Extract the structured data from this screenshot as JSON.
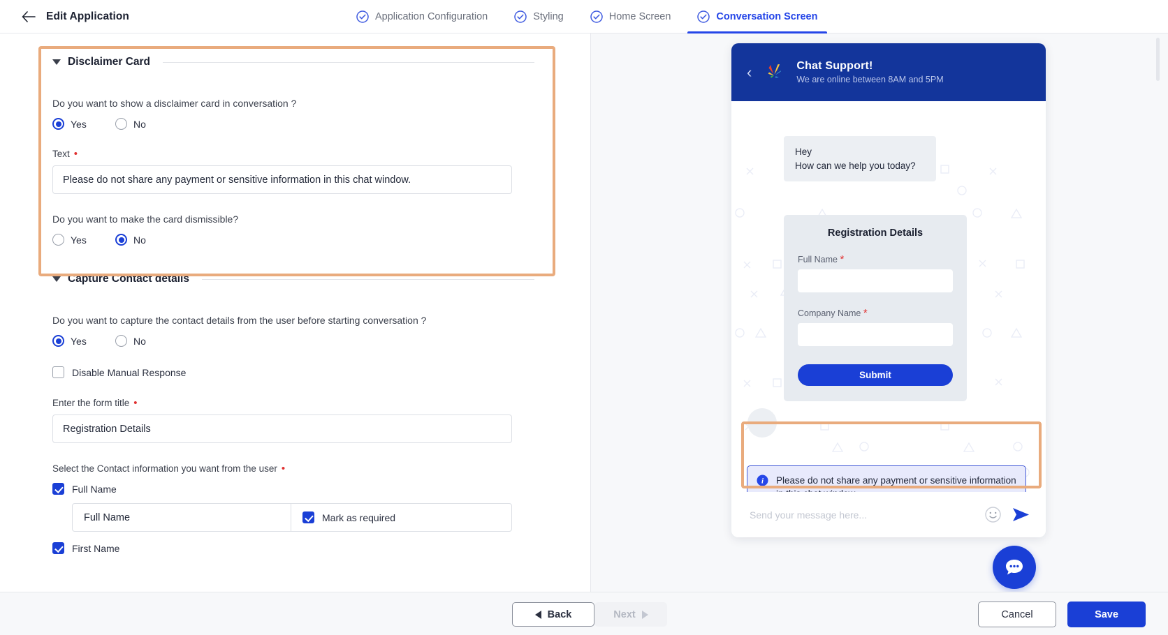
{
  "header": {
    "back_icon": "arrow-left-icon",
    "title": "Edit Application",
    "steps": [
      {
        "label": "Application Configuration",
        "icon": "check-circle-icon",
        "active": false
      },
      {
        "label": "Styling",
        "icon": "check-circle-icon",
        "active": false
      },
      {
        "label": "Home Screen",
        "icon": "check-circle-icon",
        "active": false
      },
      {
        "label": "Conversation Screen",
        "icon": "check-circle-icon",
        "active": true
      }
    ]
  },
  "disclaimer_section": {
    "title": "Disclaimer Card",
    "show_question": "Do you want to show a disclaimer card in conversation ?",
    "show_options": [
      {
        "label": "Yes",
        "selected": true
      },
      {
        "label": "No",
        "selected": false
      }
    ],
    "text_label": "Text",
    "text_value": "Please do not share any payment or sensitive information in this chat window.",
    "dismissible_question": "Do you want to make the card dismissible?",
    "dismissible_options": [
      {
        "label": "Yes",
        "selected": false
      },
      {
        "label": "No",
        "selected": true
      }
    ]
  },
  "contact_section": {
    "title": "Capture Contact details",
    "capture_question": "Do you want to capture the contact details from the user before starting conversation ?",
    "capture_options": [
      {
        "label": "Yes",
        "selected": true
      },
      {
        "label": "No",
        "selected": false
      }
    ],
    "disable_manual_label": "Disable Manual Response",
    "disable_manual_checked": false,
    "form_title_label": "Enter the form title",
    "form_title_value": "Registration Details",
    "select_info_label": "Select the Contact information you want from the user",
    "fields": [
      {
        "label": "Full Name",
        "checked": true,
        "display_name": "Full Name",
        "required_label": "Mark as required",
        "required_checked": true
      },
      {
        "label": "First Name",
        "checked": true
      }
    ]
  },
  "preview": {
    "header": {
      "back_icon": "chevron-left-icon",
      "logo_icon": "brand-splash-logo",
      "title": "Chat Support!",
      "subtitle": "We are online between 8AM and 5PM"
    },
    "greeting_line1": "Hey",
    "greeting_line2": "How can we help you today?",
    "form": {
      "title": "Registration Details",
      "fields": [
        {
          "label": "Full Name",
          "required": true,
          "value": ""
        },
        {
          "label": "Company Name",
          "required": true,
          "value": ""
        }
      ],
      "submit_label": "Submit"
    },
    "disclaimer": {
      "icon": "info-icon",
      "text": "Please do not share any payment or sensitive information in this chat window."
    },
    "composer": {
      "placeholder": "Send your message here...",
      "emoji_icon": "emoji-smiley-icon",
      "send_icon": "send-arrow-icon"
    },
    "fab_icon": "chat-bubble-icon"
  },
  "footer": {
    "back_label": "Back",
    "next_label": "Next",
    "cancel_label": "Cancel",
    "save_label": "Save"
  },
  "colors": {
    "accent_blue": "#1a3fd6",
    "header_blue": "#13359b",
    "highlight_orange": "#e9ab7d",
    "required_red": "#e03131"
  }
}
